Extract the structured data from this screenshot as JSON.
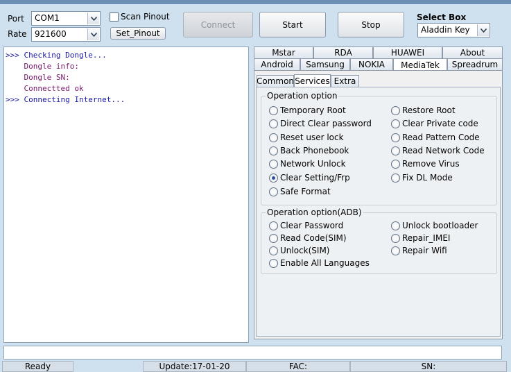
{
  "top": {
    "port_label": "Port",
    "port_value": "COM1",
    "rate_label": "Rate",
    "rate_value": "921600",
    "scan_pinout_label": "Scan Pinout",
    "set_pinout_label": "Set_Pinout",
    "connect_label": "Connect",
    "start_label": "Start",
    "stop_label": "Stop",
    "select_box_label": "Select Box",
    "select_box_value": "Aladdin Key"
  },
  "log": {
    "lines": [
      {
        "text": ">>> Checking Dongle...",
        "color": "#1a1aa8"
      },
      {
        "text": "    Dongle info:",
        "color": "#7a1a6e"
      },
      {
        "text": "    Dongle SN:",
        "color": "#7a1a6e"
      },
      {
        "text": "    Connectted ok",
        "color": "#7a1a6e"
      },
      {
        "text": ">>> Connecting Internet...",
        "color": "#1a1aa8"
      }
    ]
  },
  "tabs_row1": [
    "Mstar",
    "RDA",
    "HUAWEI",
    "About"
  ],
  "tabs_row2": [
    "Android",
    "Samsung",
    "NOKIA",
    "MediaTek",
    "Spreadrum"
  ],
  "active_tab": "MediaTek",
  "subtabs": [
    "Common",
    "Services",
    "Extra"
  ],
  "active_subtab": "Services",
  "group1": {
    "title": "Operation option",
    "left": [
      "Temporary Root",
      "Direct Clear password",
      "Reset user lock",
      "Back Phonebook",
      "Network Unlock",
      "Clear Setting/Frp",
      "Safe Format"
    ],
    "right": [
      "Restore Root",
      "Clear Private code",
      "Read Pattern Code",
      "Read Network Code",
      "Remove Virus",
      "Fix DL Mode"
    ],
    "selected": "Clear Setting/Frp"
  },
  "group2": {
    "title": "Operation option(ADB)",
    "left": [
      "Clear Password",
      "Read Code(SIM)",
      "Unlock(SIM)",
      "Enable All Languages"
    ],
    "right": [
      "Unlock bootloader",
      "Repair_IMEI",
      "Repair Wifi"
    ]
  },
  "status": {
    "ready": "Ready",
    "update": "Update:17-01-20",
    "fac": "FAC:",
    "sn": "SN:"
  }
}
